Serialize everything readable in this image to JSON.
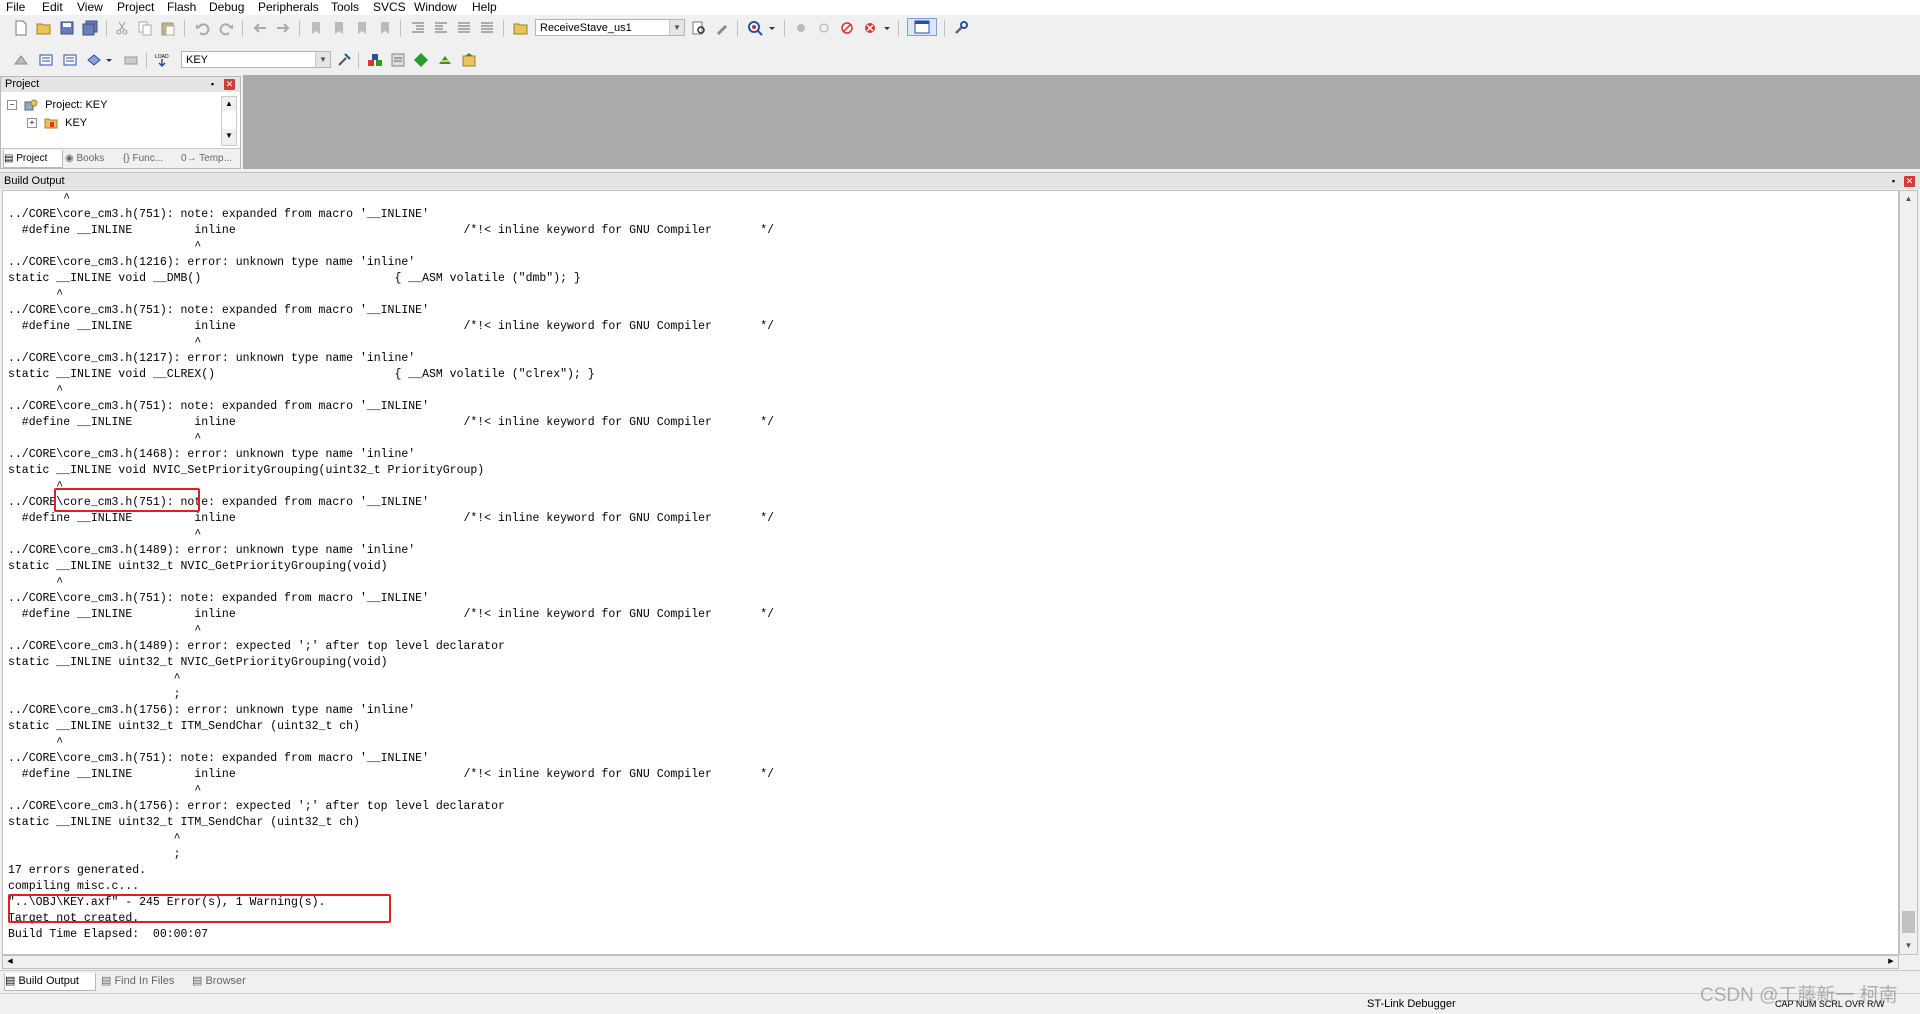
{
  "menu": [
    "File",
    "Edit",
    "View",
    "Project",
    "Flash",
    "Debug",
    "Peripherals",
    "Tools",
    "SVCS",
    "Window",
    "Help"
  ],
  "toolbar1": {
    "icons": [
      "new-file-icon",
      "open-file-icon",
      "save-icon",
      "save-all-icon",
      "cut-icon",
      "copy-icon",
      "paste-icon",
      "undo-icon",
      "redo-icon",
      "navigate-back-icon",
      "navigate-forward-icon",
      "bookmark-icon",
      "prev-bookmark-icon",
      "next-bookmark-icon",
      "clear-bookmarks-icon",
      "indent-icon",
      "unindent-icon",
      "comment-icon",
      "uncomment-icon",
      "open-file-dropdown-icon"
    ],
    "find_combo": "ReceiveStave_us1",
    "icons_after": [
      "find-in-files-icon",
      "incremental-find-icon",
      "debug-session-icon",
      "breakpoint-insert-icon",
      "breakpoint-enable-icon",
      "breakpoint-disable-icon",
      "breakpoint-kill-icon",
      "window-layout-icon",
      "configure-icon"
    ]
  },
  "toolbar2": {
    "icons": [
      "translate-icon",
      "build-icon",
      "rebuild-icon",
      "batch-build-icon",
      "stop-build-icon",
      "download-icon"
    ],
    "target_combo": "KEY",
    "icons_after": [
      "target-options-icon",
      "manage-components-icon",
      "select-pack-icon",
      "pack-installer-icon",
      "manage-run-time-icon",
      "software-packs-icon"
    ]
  },
  "project_panel": {
    "title": "Project",
    "tree": [
      {
        "label": "Project: KEY",
        "expander": "−"
      },
      {
        "label": "KEY",
        "expander": "+"
      }
    ],
    "tabs": [
      "Project",
      "Books",
      "{} Func...",
      "0→ Temp..."
    ]
  },
  "build_output": {
    "title": "Build Output",
    "lines": [
      "        ^",
      "../CORE\\core_cm3.h(751): note: expanded from macro '__INLINE'",
      "  #define __INLINE         inline                                 /*!< inline keyword for GNU Compiler       */",
      "                           ^",
      "../CORE\\core_cm3.h(1216): error: unknown type name 'inline'",
      "static __INLINE void __DMB()                            { __ASM volatile (\"dmb\"); }",
      "       ^",
      "../CORE\\core_cm3.h(751): note: expanded from macro '__INLINE'",
      "  #define __INLINE         inline                                 /*!< inline keyword for GNU Compiler       */",
      "                           ^",
      "../CORE\\core_cm3.h(1217): error: unknown type name 'inline'",
      "static __INLINE void __CLREX()                          { __ASM volatile (\"clrex\"); }",
      "       ^",
      "../CORE\\core_cm3.h(751): note: expanded from macro '__INLINE'",
      "  #define __INLINE         inline                                 /*!< inline keyword for GNU Compiler       */",
      "                           ^",
      "../CORE\\core_cm3.h(1468): error: unknown type name 'inline'",
      "static __INLINE void NVIC_SetPriorityGrouping(uint32_t PriorityGroup)",
      "       ^",
      "../CORE\\core_cm3.h(751): note: expanded from macro '__INLINE'",
      "  #define __INLINE         inline                                 /*!< inline keyword for GNU Compiler       */",
      "                           ^",
      "../CORE\\core_cm3.h(1489): error: unknown type name 'inline'",
      "static __INLINE uint32_t NVIC_GetPriorityGrouping(void)",
      "       ^",
      "../CORE\\core_cm3.h(751): note: expanded from macro '__INLINE'",
      "  #define __INLINE         inline                                 /*!< inline keyword for GNU Compiler       */",
      "                           ^",
      "../CORE\\core_cm3.h(1489): error: expected ';' after top level declarator",
      "static __INLINE uint32_t NVIC_GetPriorityGrouping(void)",
      "                        ^",
      "                        ;",
      "../CORE\\core_cm3.h(1756): error: unknown type name 'inline'",
      "static __INLINE uint32_t ITM_SendChar (uint32_t ch)",
      "       ^",
      "../CORE\\core_cm3.h(751): note: expanded from macro '__INLINE'",
      "  #define __INLINE         inline                                 /*!< inline keyword for GNU Compiler       */",
      "                           ^",
      "../CORE\\core_cm3.h(1756): error: expected ';' after top level declarator",
      "static __INLINE uint32_t ITM_SendChar (uint32_t ch)",
      "                        ^",
      "                        ;",
      "17 errors generated.",
      "compiling misc.c...",
      "\"..\\OBJ\\KEY.axf\" - 245 Error(s), 1 Warning(s).",
      "Target not created.",
      "Build Time Elapsed:  00:00:07"
    ]
  },
  "bottom_tabs": [
    "Build Output",
    "Find In Files",
    "Browser"
  ],
  "status": {
    "debugger": "ST-Link Debugger",
    "indicators": "CAP  NUM  SCRL  OVR  R/W"
  },
  "watermark": "CSDN @工藤新一  柯南",
  "colors": {
    "highlight": "#e02020",
    "panel_gray": "#ababab"
  }
}
